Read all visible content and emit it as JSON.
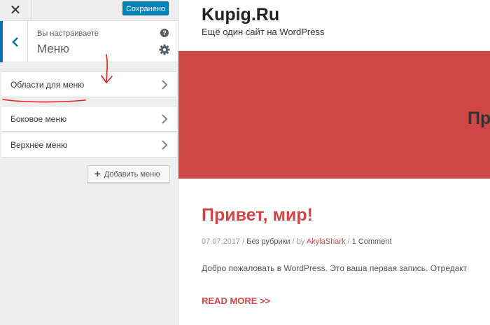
{
  "customizer": {
    "close_glyph": "✕",
    "save_label": "Сохранено",
    "subtitle": "Вы настраиваете",
    "section_title": "Меню",
    "help_glyph": "?",
    "items": [
      {
        "label": "Области для меню"
      },
      {
        "label": "Боковое меню"
      },
      {
        "label": "Верхнее меню"
      }
    ],
    "add_menu_label": "Добавить меню",
    "colors": {
      "accent": "#0073aa",
      "save_button": "#0085ba",
      "panel_bg": "#eeeeee",
      "annotation": "#e0201e"
    }
  },
  "site": {
    "title": "Kupig.Ru",
    "tagline": "Ещё один сайт на WordPress",
    "hero_text": "Пр",
    "post": {
      "title": "Привет, мир!",
      "date": "07.07.2017",
      "sep1": " / ",
      "category": "Без рубрики",
      "sep2": " / by ",
      "author": "AkylaShark",
      "sep3": " / ",
      "comments": "1 Comment",
      "excerpt": "Добро пожаловать в WordPress. Это ваша первая запись. Отредакт",
      "read_more": "READ MORE >>"
    },
    "colors": {
      "hero_bg": "#d04646",
      "link": "#d04646"
    }
  }
}
